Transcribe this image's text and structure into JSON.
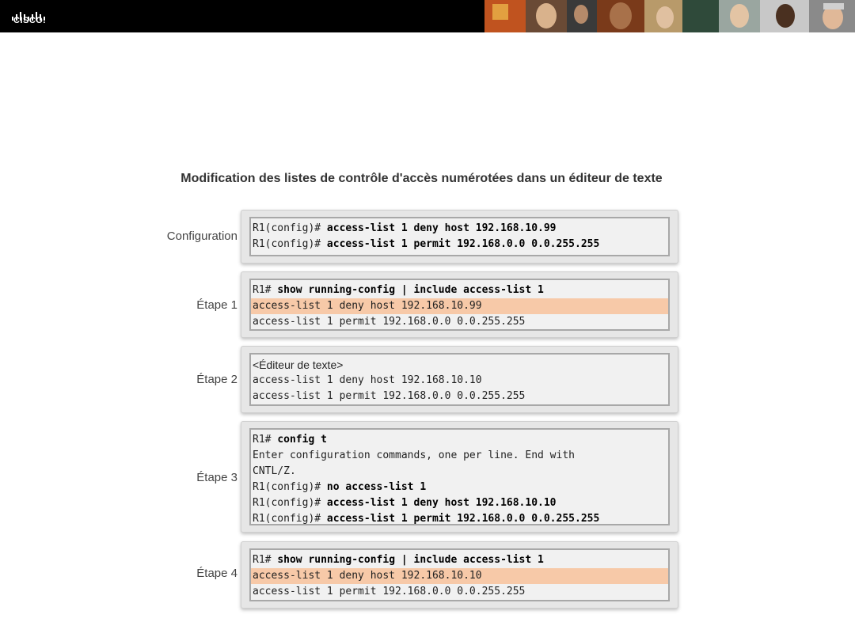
{
  "brand": {
    "logo_text": "CISCO."
  },
  "title": "Modification des listes de contrôle d'accès numérotées dans un éditeur de texte",
  "colors": {
    "highlight": "#f7c9a8",
    "header_bg": "#000000",
    "panel_bg": "#e6e6e6"
  },
  "configuration": {
    "label": "Configuration",
    "lines": [
      {
        "prompt": "R1(config)# ",
        "cmd": "access-list 1 deny host 192.168.10.99"
      },
      {
        "prompt": "R1(config)# ",
        "cmd": "access-list 1 permit 192.168.0.0 0.0.255.255"
      }
    ]
  },
  "step1": {
    "label": "Étape 1",
    "lines": [
      {
        "prompt": "R1# ",
        "cmd": "show running-config | include access-list 1"
      },
      {
        "text": "access-list 1 deny host 192.168.10.99"
      },
      {
        "text": "access-list 1 permit 192.168.0.0 0.0.255.255"
      }
    ]
  },
  "step2": {
    "label": "Étape 2",
    "lines": [
      {
        "text": "<Éditeur de texte>"
      },
      {
        "text": "access-list 1 deny host 192.168.10.10"
      },
      {
        "text": "access-list 1 permit 192.168.0.0 0.0.255.255"
      }
    ]
  },
  "step3": {
    "label": "Étape 3",
    "lines": [
      {
        "prompt": "R1# ",
        "cmd": "config t"
      },
      {
        "text": "Enter configuration commands, one per line. End with"
      },
      {
        "text": "CNTL/Z."
      },
      {
        "prompt": "R1(config)# ",
        "cmd": "no access-list 1"
      },
      {
        "prompt": "R1(config)# ",
        "cmd": "access-list 1 deny host 192.168.10.10"
      },
      {
        "prompt": "R1(config)# ",
        "cmd": "access-list 1 permit 192.168.0.0 0.0.255.255"
      }
    ]
  },
  "step4": {
    "label": "Étape 4",
    "lines": [
      {
        "prompt": "R1# ",
        "cmd": "show running-config | include access-list 1"
      },
      {
        "text": "access-list 1 deny host 192.168.10.10"
      },
      {
        "text": "access-list 1 permit 192.168.0.0 0.0.255.255"
      }
    ]
  }
}
